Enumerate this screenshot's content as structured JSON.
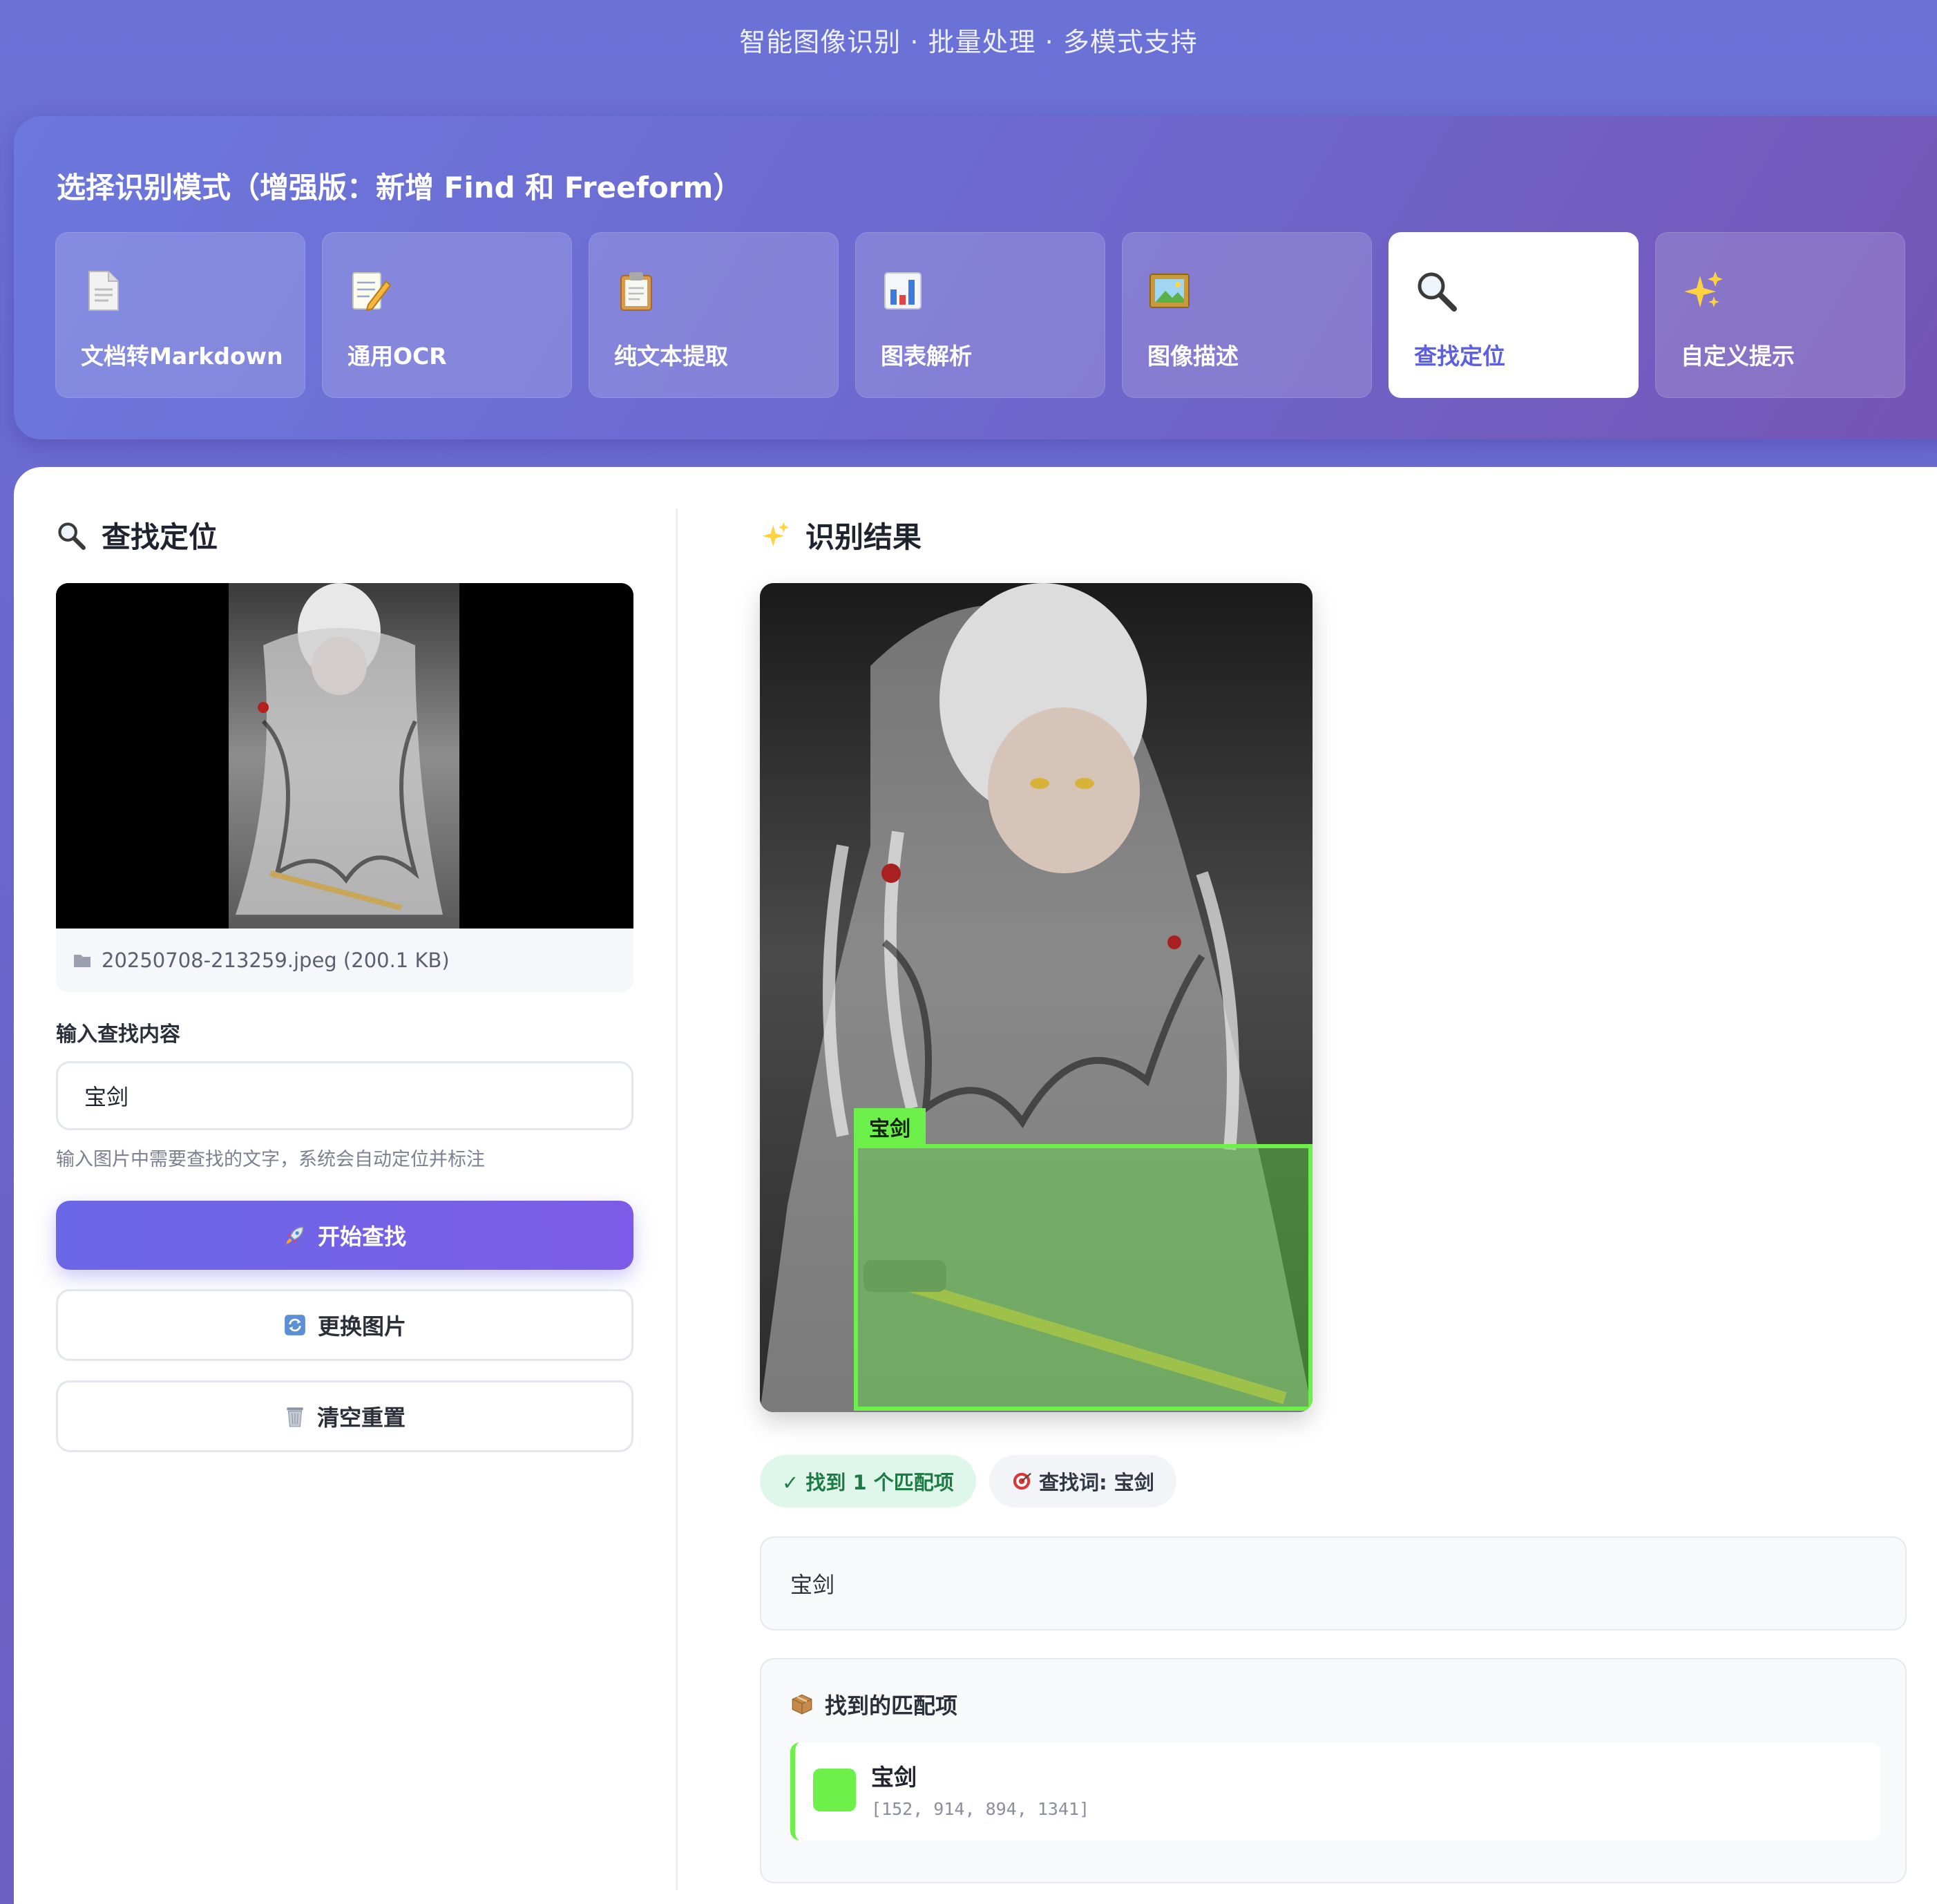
{
  "header": {
    "subtitle": "智能图像识别 · 批量处理 · 多模式支持"
  },
  "modes": {
    "title": "选择识别模式（增强版：新增 Find 和 Freeform）",
    "items": [
      {
        "label": "文档转Markdown",
        "icon": "document-icon"
      },
      {
        "label": "通用OCR",
        "icon": "memo-icon"
      },
      {
        "label": "纯文本提取",
        "icon": "clipboard-icon"
      },
      {
        "label": "图表解析",
        "icon": "bar-chart-icon"
      },
      {
        "label": "图像描述",
        "icon": "framed-picture-icon"
      },
      {
        "label": "查找定位",
        "icon": "magnifier-icon",
        "active": true
      },
      {
        "label": "自定义提示",
        "icon": "sparkles-icon"
      }
    ]
  },
  "left": {
    "title": "查找定位",
    "file_info": "20250708-213259.jpeg (200.1 KB)",
    "input_label": "输入查找内容",
    "input_value": "宝剑",
    "hint": "输入图片中需要查找的文字，系统会自动定位并标注",
    "start_button": "开始查找",
    "change_button": "更换图片",
    "clear_button": "清空重置"
  },
  "right": {
    "title": "识别结果",
    "bbox_label": "宝剑",
    "found_badge": "✓ 找到 1 个匹配项",
    "search_term_badge": "查找词: 宝剑",
    "result_text": "宝剑",
    "matches_title": "找到的匹配项",
    "matches": [
      {
        "label": "宝剑",
        "coords": "[152, 914, 894, 1341]",
        "color": "#6ef04a"
      }
    ]
  },
  "colors": {
    "accent": "#6a67e6",
    "match_green": "#6ef04a",
    "success_bg": "#dff7ea"
  }
}
